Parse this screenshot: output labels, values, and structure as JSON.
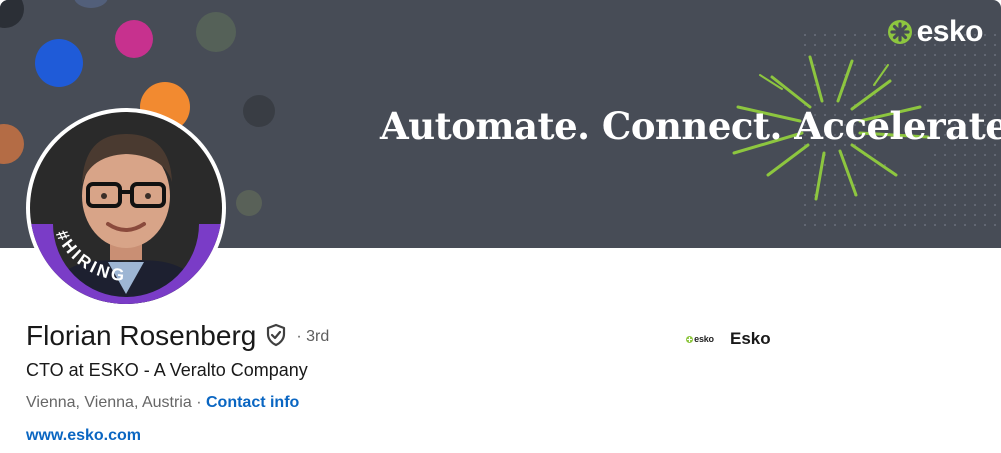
{
  "banner": {
    "tagline": "Automate. Connect. Accelerate.",
    "brand_word": "esko",
    "background_color": "#474c56",
    "accent_color": "#8dc63f"
  },
  "avatar": {
    "badge_text": "#HIRING",
    "badge_color": "#7a3cc7"
  },
  "profile": {
    "name": "Florian Rosenberg",
    "degree": "· 3rd",
    "headline": "CTO at ESKO - A Veralto Company",
    "location": "Vienna, Vienna, Austria ·",
    "contact_label": "Contact info",
    "website": "www.esko.com"
  },
  "company": {
    "logo_word": "esko",
    "name": "Esko"
  },
  "icons": {
    "verified": "shield-check-icon"
  }
}
